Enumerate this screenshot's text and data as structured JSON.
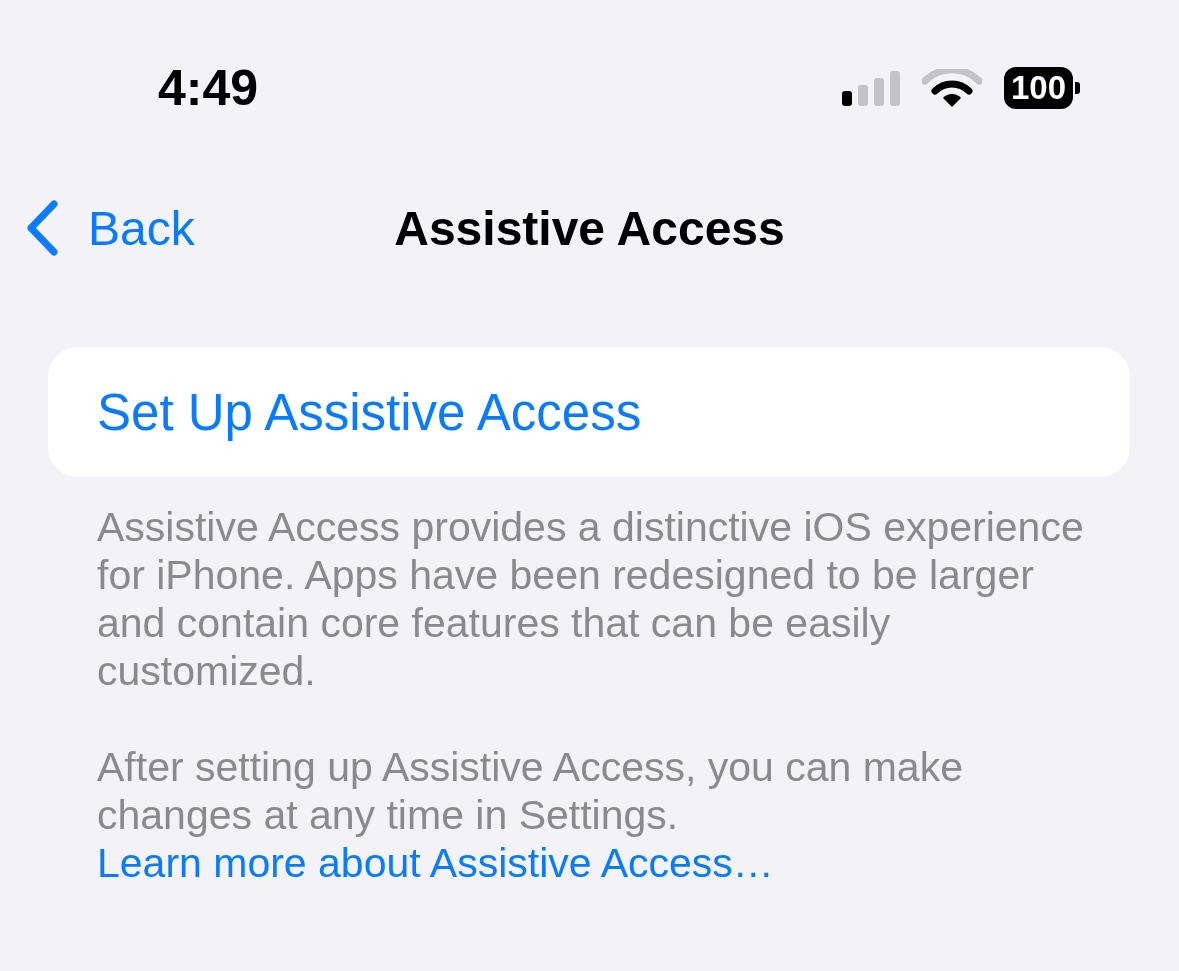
{
  "status_bar": {
    "time": "4:49",
    "battery": "100"
  },
  "nav": {
    "back": "Back",
    "title": "Assistive Access"
  },
  "setup_button": {
    "label": "Set Up Assistive Access"
  },
  "footer": {
    "paragraphs": [
      {
        "text": "Assistive Access provides a distinctive iOS experience for iPhone. Apps have been redesigned to be larger and contain core features that can be easily customized."
      },
      {
        "text": "After setting up Assistive Access, you can make changes at any time in Settings.",
        "link": "Learn more about Assistive Access…"
      }
    ]
  }
}
